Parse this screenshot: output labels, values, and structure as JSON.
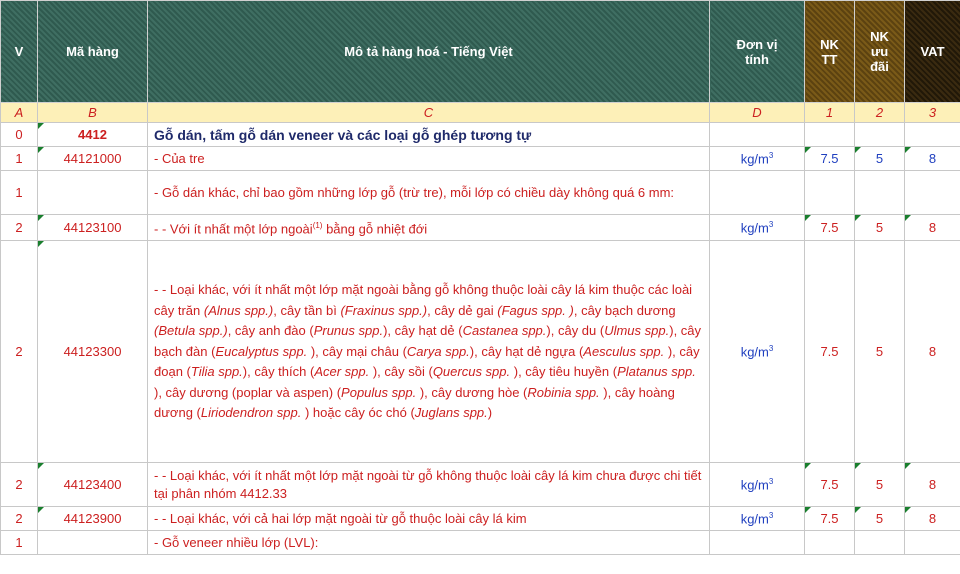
{
  "header": {
    "col_v": "V",
    "col_code": "Mã hàng",
    "col_desc": "Mô tả hàng hoá - Tiếng Việt",
    "col_unit_1": "Đơn vị",
    "col_unit_2": "tính",
    "col_nktt_1": "NK",
    "col_nktt_2": "TT",
    "col_nkud_1": "NK",
    "col_nkud_2": "ưu",
    "col_nkud_3": "đãi",
    "col_vat": "VAT"
  },
  "letters": [
    "A",
    "B",
    "C",
    "D",
    "1",
    "2",
    "3"
  ],
  "rows": [
    {
      "v": "0",
      "code": "4412",
      "desc": "Gỗ dán, tấm gỗ dán veneer và các loại gỗ ghép tương tự",
      "unit": "",
      "nktt": "",
      "nkud": "",
      "vat": ""
    },
    {
      "v": "1",
      "code": "44121000",
      "desc": "- Của tre",
      "unit": "kg/m",
      "nktt": "7.5",
      "nkud": "5",
      "vat": "8"
    },
    {
      "v": "1",
      "code": "",
      "desc": "- Gỗ dán khác, chỉ bao gồm những lớp gỗ (trừ tre), mỗi lớp có chiều dày không quá 6 mm:",
      "unit": "",
      "nktt": "",
      "nkud": "",
      "vat": ""
    },
    {
      "v": "2",
      "code": "44123100",
      "desc_pre": "- - Với ít nhất một lớp ngoài",
      "desc_sup": "(1)",
      "desc_post": " bằng gỗ nhiệt đới",
      "unit": "kg/m",
      "nktt": "7.5",
      "nkud": "5",
      "vat": "8"
    },
    {
      "v": "2",
      "code": "44123300",
      "desc_parts": [
        "- - Loại khác, với ít nhất một lớp mặt ngoài bằng gỗ không thuộc loài cây lá kim thuộc các loài cây trăn ",
        "(Alnus spp.)",
        ", cây tần bì ",
        "(Fraxinus spp.)",
        ", cây dẻ gai ",
        "(Fagus spp. )",
        ", cây bạch dương ",
        "(Betula spp.)",
        ", cây anh đào (",
        "Prunus spp.",
        "), cây hạt dẻ (",
        "Castanea spp.",
        "), cây du (",
        "Ulmus spp.",
        "), cây bạch đàn (",
        "Eucalyptus spp.",
        " ), cây mại châu (",
        "Carya spp.",
        "), cây hạt dẻ ngựa (",
        "Aesculus spp.",
        " ), cây đoạn (",
        "Tilia spp.",
        "), cây thích (",
        "Acer spp.",
        " ), cây sồi (",
        "Quercus spp.",
        " ), cây tiêu huyền (",
        "Platanus spp.",
        " ), cây dương (poplar và aspen) (",
        "Populus spp.",
        " ), cây dương hòe (",
        "Robinia spp.",
        " ), cây hoàng dương (",
        "Liriodendron spp.",
        " ) hoặc cây óc chó (",
        "Juglans spp.",
        ")"
      ],
      "unit": "kg/m",
      "nktt": "7.5",
      "nkud": "5",
      "vat": "8"
    },
    {
      "v": "2",
      "code": "44123400",
      "desc": "- - Loại khác, với ít nhất một lớp mặt ngoài từ gỗ không thuộc loài cây lá kim chưa được chi tiết tại phân nhóm 4412.33",
      "unit": "kg/m",
      "nktt": "7.5",
      "nkud": "5",
      "vat": "8"
    },
    {
      "v": "2",
      "code": "44123900",
      "desc": "- - Loại khác, với cả hai lớp mặt ngoài từ gỗ thuộc loài cây lá kim",
      "unit": "kg/m",
      "nktt": "7.5",
      "nkud": "5",
      "vat": "8"
    },
    {
      "v": "1",
      "code": "",
      "desc": "- Gỗ veneer nhiều lớp (LVL):",
      "unit": "",
      "nktt": "",
      "nkud": "",
      "vat": ""
    }
  ],
  "unit_sup": "3",
  "colors": {
    "header_green": "#3f6e62",
    "header_brown": "#7a5a18",
    "header_dark": "#3a2a10",
    "letter_row": "#fdf0b8",
    "text_red": "#cc2020",
    "text_blue": "#1f3fbf"
  }
}
